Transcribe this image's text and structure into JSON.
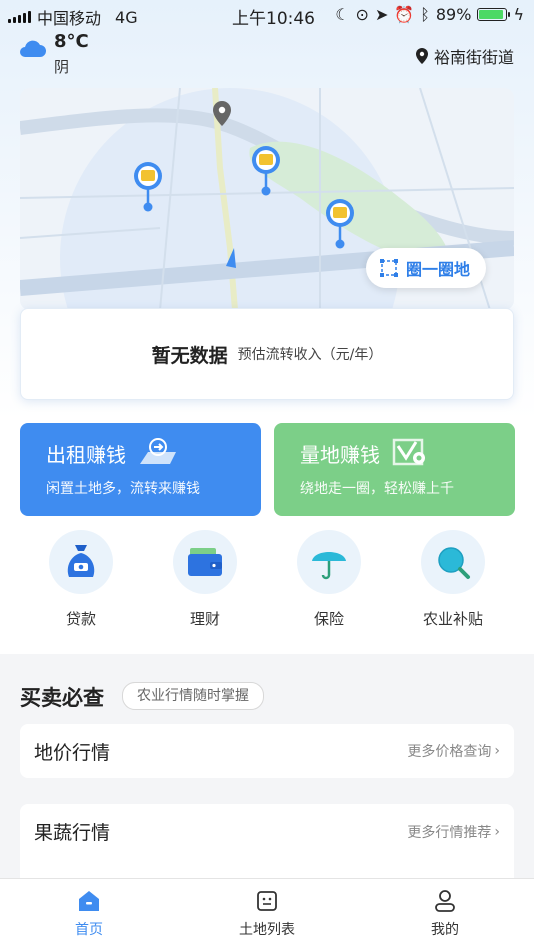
{
  "status_bar": {
    "carrier": "中国移动",
    "network": "4G",
    "time": "上午10:46",
    "battery": "89%",
    "battery_level": 0.89
  },
  "weather": {
    "temperature": "8°C",
    "condition": "阴",
    "location": "裕南街街道"
  },
  "map": {
    "circle_button_label": "圈一圈地"
  },
  "data_card": {
    "main": "暂无数据",
    "sub": "预估流转收入（元/年）"
  },
  "feature_cards": [
    {
      "title": "出租赚钱",
      "desc": "闲置土地多，流转来赚钱",
      "color": "#3f8cf0"
    },
    {
      "title": "量地赚钱",
      "desc": "绕地走一圈，轻松赚上千",
      "color": "#7ccf88"
    }
  ],
  "services": [
    {
      "label": "贷款",
      "icon": "money-bag-icon"
    },
    {
      "label": "理财",
      "icon": "wallet-icon"
    },
    {
      "label": "保险",
      "icon": "umbrella-icon"
    },
    {
      "label": "农业补贴",
      "icon": "magnifier-icon"
    }
  ],
  "market_section": {
    "title": "买卖必查",
    "tag": "农业行情随时掌握",
    "rows": [
      {
        "name": "地价行情",
        "more": "更多价格查询"
      },
      {
        "name": "果蔬行情",
        "more": "更多行情推荐"
      }
    ]
  },
  "tabbar": {
    "items": [
      {
        "label": "首页",
        "active": true
      },
      {
        "label": "土地列表",
        "active": false
      },
      {
        "label": "我的",
        "active": false
      }
    ]
  },
  "accent_color": "#3f8cf0"
}
